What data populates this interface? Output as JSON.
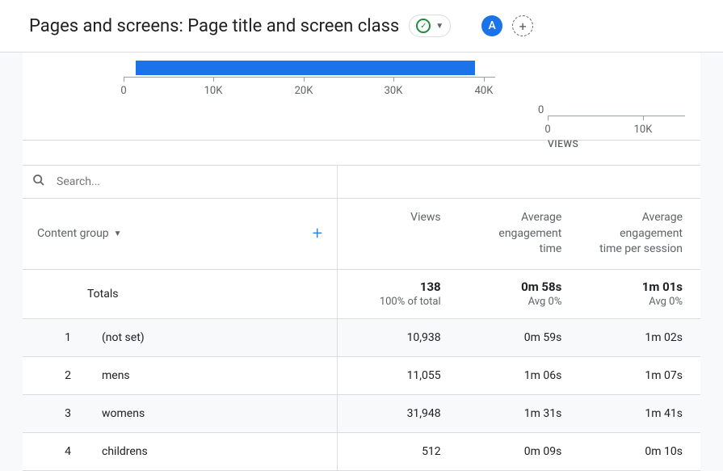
{
  "header": {
    "title": "Pages and screens: Page title and screen class",
    "avatar_letter": "A"
  },
  "chart_data": {
    "left": {
      "type": "bar",
      "ticks": [
        "0",
        "10K",
        "20K",
        "30K",
        "40K"
      ],
      "bar_value_estimate": 40000
    },
    "right": {
      "y_zero": "0",
      "x_ticks": [
        "0",
        "10K"
      ],
      "axis_label": "VIEWS"
    }
  },
  "search": {
    "placeholder": "Search..."
  },
  "table": {
    "dimension_label": "Content group",
    "metrics": [
      "Views",
      "Average engagement time",
      "Average engagement time per session"
    ],
    "totals": {
      "label": "Totals",
      "views": "138",
      "views_sub": "100% of total",
      "aet": "0m 58s",
      "aet_sub": "Avg 0%",
      "aets": "1m 01s",
      "aets_sub": "Avg 0%"
    },
    "rows": [
      {
        "n": "1",
        "dim": "(not set)",
        "views": "10,938",
        "aet": "0m 59s",
        "aets": "1m 02s"
      },
      {
        "n": "2",
        "dim": "mens",
        "views": "11,055",
        "aet": "1m 06s",
        "aets": "1m 07s"
      },
      {
        "n": "3",
        "dim": "womens",
        "views": "31,948",
        "aet": "1m 31s",
        "aets": "1m 41s"
      },
      {
        "n": "4",
        "dim": "childrens",
        "views": "512",
        "aet": "0m 09s",
        "aets": "0m 10s"
      }
    ]
  }
}
